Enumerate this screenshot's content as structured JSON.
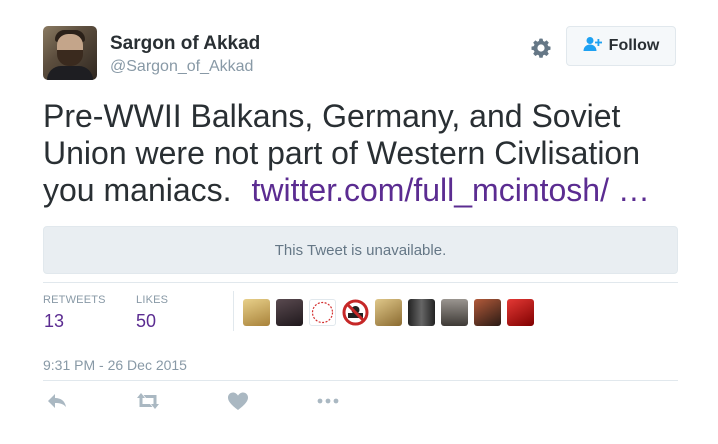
{
  "user": {
    "name": "Sargon of Akkad",
    "handle": "@Sargon_of_Akkad"
  },
  "follow_button": {
    "label": "Follow"
  },
  "tweet": {
    "text": "Pre-WWII Balkans, Germany, and Soviet Union were not part of Western Civlisation you maniacs.",
    "link": "twitter.com/full_mcintosh/ …"
  },
  "quoted_tweet": {
    "text": "This Tweet is unavailable."
  },
  "stats": {
    "retweets_label": "RETWEETS",
    "retweets_count": "13",
    "likes_label": "LIKES",
    "likes_count": "50"
  },
  "liker_avatars": [
    {
      "icon": "liker-avatar",
      "color": "#c9a35a"
    },
    {
      "icon": "liker-avatar",
      "color": "#3a3038"
    },
    {
      "icon": "liker-avatar",
      "color": "#e9e2df"
    },
    {
      "icon": "liker-avatar",
      "color": "#c62828"
    },
    {
      "icon": "liker-avatar",
      "color": "#b89a62"
    },
    {
      "icon": "liker-avatar",
      "color": "#404040"
    },
    {
      "icon": "liker-avatar",
      "color": "#6d6a66"
    },
    {
      "icon": "liker-avatar",
      "color": "#7a3a2a"
    },
    {
      "icon": "liker-avatar",
      "color": "#b71c1c"
    }
  ],
  "timestamp": "9:31 PM - 26 Dec 2015",
  "actions": [
    {
      "icon": "reply-icon"
    },
    {
      "icon": "retweet-icon"
    },
    {
      "icon": "like-icon"
    },
    {
      "icon": "more-icon"
    }
  ],
  "colors": {
    "link": "#5b2c91",
    "muted": "#8899a6",
    "text": "#292f33",
    "quote_bg": "#e9eef2",
    "action_icon": "#aab8c2"
  }
}
